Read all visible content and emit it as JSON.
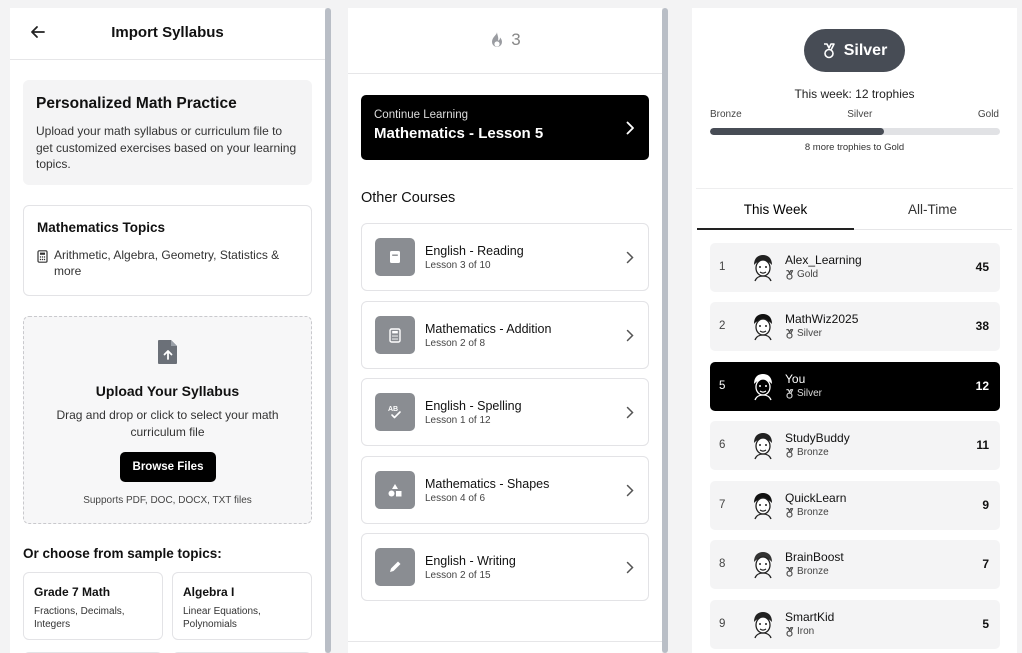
{
  "import": {
    "title": "Import Syllabus",
    "intro_title": "Personalized Math Practice",
    "intro_desc": "Upload your math syllabus or curriculum file to get customized exercises based on your learning topics.",
    "topics_title": "Mathematics Topics",
    "topics_desc": "Arithmetic, Algebra, Geometry, Statistics & more",
    "upload_title": "Upload Your Syllabus",
    "upload_desc": "Drag and drop or click to select your math curriculum file",
    "browse_label": "Browse Files",
    "supports": "Supports PDF, DOC, DOCX, TXT files",
    "sample_heading": "Or choose from sample topics:",
    "samples": [
      {
        "title": "Grade 7 Math",
        "desc": "Fractions, Decimals, Integers"
      },
      {
        "title": "Algebra I",
        "desc": "Linear Equations, Polynomials"
      }
    ]
  },
  "courses": {
    "streak_count": "3",
    "continue_label": "Continue Learning",
    "continue_title": "Mathematics - Lesson 5",
    "other_heading": "Other Courses",
    "list": [
      {
        "title": "English - Reading",
        "sub": "Lesson 3 of 10",
        "icon": "book-icon"
      },
      {
        "title": "Mathematics - Addition",
        "sub": "Lesson 2 of 8",
        "icon": "calculator-icon"
      },
      {
        "title": "English - Spelling",
        "sub": "Lesson 1 of 12",
        "icon": "spellcheck-icon"
      },
      {
        "title": "Mathematics - Shapes",
        "sub": "Lesson 4 of 6",
        "icon": "shapes-icon"
      },
      {
        "title": "English - Writing",
        "sub": "Lesson 2 of 15",
        "icon": "pencil-icon"
      }
    ]
  },
  "leaderboard": {
    "league": "Silver",
    "week_trophies": "This week: 12 trophies",
    "tiers": [
      "Bronze",
      "Silver",
      "Gold"
    ],
    "progress_fraction": 0.6,
    "more_trophies": "8 more trophies to Gold",
    "tabs": [
      "This Week",
      "All-Time"
    ],
    "rows": [
      {
        "rank": "1",
        "name": "Alex_Learning",
        "league": "Gold",
        "score": "45",
        "me": false
      },
      {
        "rank": "2",
        "name": "MathWiz2025",
        "league": "Silver",
        "score": "38",
        "me": false
      },
      {
        "rank": "5",
        "name": "You",
        "league": "Silver",
        "score": "12",
        "me": true
      },
      {
        "rank": "6",
        "name": "StudyBuddy",
        "league": "Bronze",
        "score": "11",
        "me": false
      },
      {
        "rank": "7",
        "name": "QuickLearn",
        "league": "Bronze",
        "score": "9",
        "me": false
      },
      {
        "rank": "8",
        "name": "BrainBoost",
        "league": "Bronze",
        "score": "7",
        "me": false
      },
      {
        "rank": "9",
        "name": "SmartKid",
        "league": "Iron",
        "score": "5",
        "me": false
      }
    ]
  },
  "colors": {
    "accent_dark": "#474c55",
    "black": "#000000",
    "icon_gray": "#8a8d92"
  }
}
